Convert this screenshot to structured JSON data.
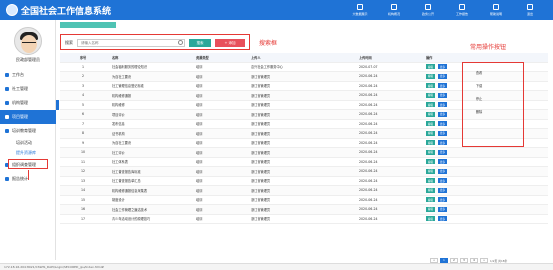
{
  "app": {
    "title": "全国社会工作信息系统"
  },
  "top_nav": [
    {
      "label": "大数据展示",
      "icon": "chart-icon"
    },
    {
      "label": "机构概况",
      "icon": "building-icon"
    },
    {
      "label": "政务公开",
      "icon": "document-icon"
    },
    {
      "label": "工作报告",
      "icon": "report-icon"
    },
    {
      "label": "帮助说明",
      "icon": "help-icon"
    },
    {
      "label": "退出",
      "icon": "exit-icon"
    }
  ],
  "user": {
    "name": "民政部管理员"
  },
  "sidebar": {
    "items": [
      {
        "label": "工作台",
        "icon": "home-icon"
      },
      {
        "label": "社工管理",
        "icon": "user-icon"
      },
      {
        "label": "机构管理",
        "icon": "org-icon"
      },
      {
        "label": "项目管理",
        "icon": "project-icon"
      },
      {
        "label": "培训教育管理",
        "icon": "training-icon"
      },
      {
        "label": "组织调查管理",
        "icon": "survey-icon"
      },
      {
        "label": "报告统计",
        "icon": "stats-icon"
      }
    ],
    "sub_items": [
      "培训活动",
      "提升资源库"
    ]
  },
  "search": {
    "label": "搜索",
    "placeholder": "请输入名称",
    "search_btn": "搜索",
    "add_btn": "+ 添加"
  },
  "annotations": {
    "search_area": "搜索框",
    "ops_area": "常用操作按钮"
  },
  "table": {
    "headers": [
      "序号",
      "名称",
      "资源类型",
      "上传人",
      "上传时间",
      "操作"
    ],
    "rows": [
      [
        "1",
        "社会福利服务的理论知识",
        "培训",
        "嘉兴社会工作服务中心",
        "2020-07-07"
      ],
      [
        "2",
        "为自社工要诀",
        "培训",
        "浙江省管理员",
        "2020-06-24"
      ],
      [
        "3",
        "社工管理信息登记标准",
        "培训",
        "浙江省管理员",
        "2020-06-24"
      ],
      [
        "4",
        "机构维修通报",
        "培训",
        "浙江省管理员",
        "2020-06-24"
      ],
      [
        "5",
        "机构维修",
        "培训",
        "浙江省管理员",
        "2020-06-24"
      ],
      [
        "6",
        "项目评价",
        "培训",
        "浙江省管理员",
        "2020-06-24"
      ],
      [
        "7",
        "发布信息",
        "培训",
        "浙江省管理员",
        "2020-06-24"
      ],
      [
        "8",
        "证书机构",
        "培训",
        "浙江省管理员",
        "2020-06-24"
      ],
      [
        "9",
        "为自社工要诀",
        "培训",
        "浙江省管理员",
        "2020-06-24"
      ],
      [
        "10",
        "社工评价",
        "培训",
        "浙江省管理员",
        "2020-06-24"
      ],
      [
        "11",
        "社工体系表",
        "培训",
        "浙江省管理员",
        "2020-06-24"
      ],
      [
        "12",
        "社工普查报告库标准",
        "培训",
        "浙江省管理员",
        "2020-06-24"
      ],
      [
        "13",
        "社工普查报告单汇总",
        "培训",
        "浙江省管理员",
        "2020-06-24"
      ],
      [
        "14",
        "机构维修通报信息采集表",
        "培训",
        "浙江省管理员",
        "2020-06-24"
      ],
      [
        "15",
        "制度设计",
        "培训",
        "浙江省管理员",
        "2020-06-24"
      ],
      [
        "16",
        "社会工作管理之廉洁技术",
        "培训",
        "浙江省管理员",
        "2020-06-24"
      ],
      [
        "17",
        "青少年活动设计的原理技巧",
        "培训",
        "浙江省管理员",
        "2020-06-24"
      ]
    ],
    "op_labels": {
      "edit": "编辑",
      "more": "更多"
    }
  },
  "ops_dropdown": [
    "查看",
    "下载",
    "停止",
    "删除"
  ],
  "pager": {
    "pages": [
      "«",
      "1",
      "2",
      "3",
      "4",
      "»"
    ],
    "current": "1",
    "summary": "1/2页 共18条"
  },
  "status_bar": {
    "url": "172.18.16.204:8021/CSWIS_DAPI/Login/SECURED_jpu/Index.html#"
  },
  "colors": {
    "primary": "#1f73d6",
    "accent": "#2aa89a",
    "danger": "#e8505b",
    "annotation": "#e53935"
  }
}
